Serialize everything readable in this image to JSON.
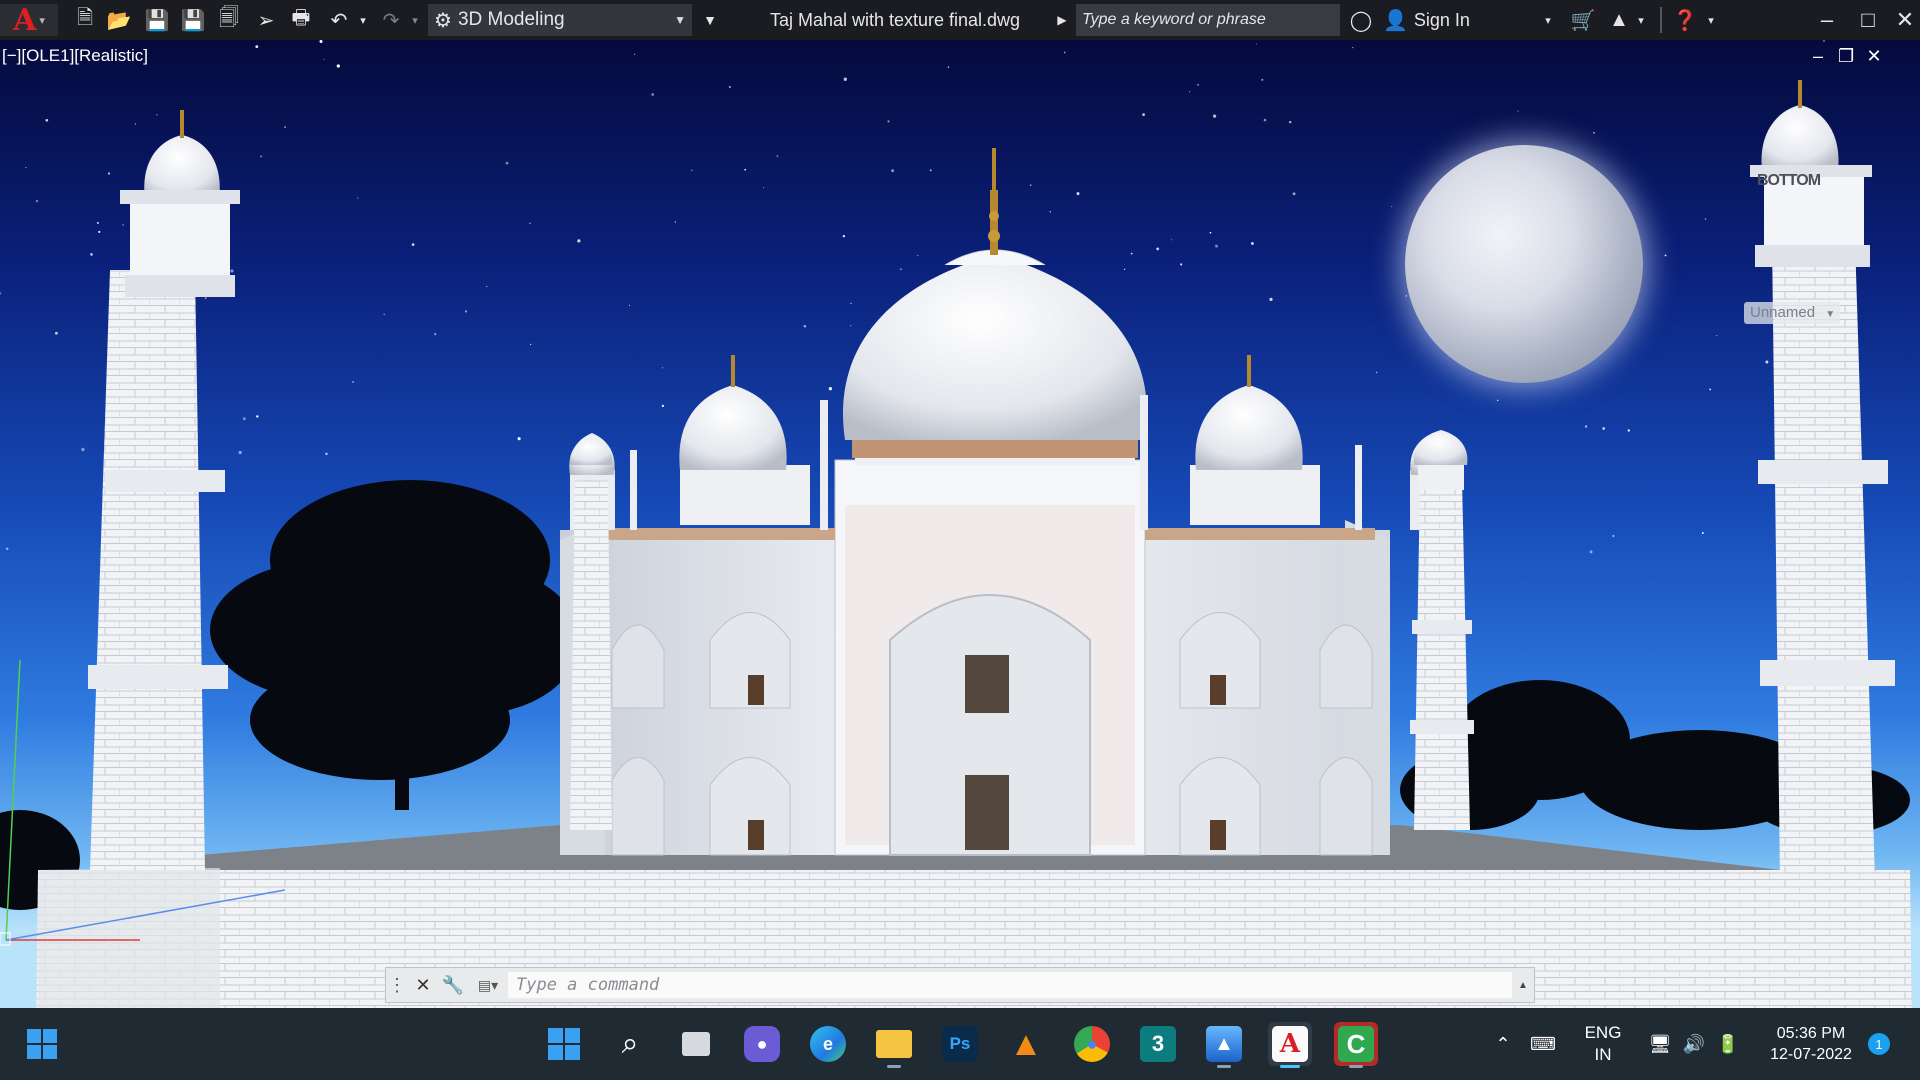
{
  "app": {
    "logo": "A",
    "workspace": "3D Modeling",
    "document_title": "Taj Mahal with texture final.dwg",
    "search_placeholder": "Type a keyword or phrase",
    "sign_in": "Sign In",
    "quick_access_icons": [
      "new-icon",
      "open-icon",
      "save-icon",
      "save-as-icon",
      "open-from-web-icon",
      "plot-export-icon",
      "plot-icon",
      "undo-icon",
      "redo-icon"
    ],
    "window_controls": [
      "minimize-icon",
      "maximize-icon",
      "close-icon"
    ]
  },
  "viewport": {
    "label": "[−][OLE1][Realistic]",
    "viewcube_face": "BOTTOM",
    "ucs_name": "Unnamed",
    "sky_top": "#050a3c",
    "sky_bottom": "#b9e2fb"
  },
  "command_line": {
    "placeholder": "Type a command"
  },
  "taskbar": {
    "pinned": [
      {
        "name": "search-icon",
        "label": "⌕"
      },
      {
        "name": "task-view-icon",
        "label": "▢"
      },
      {
        "name": "teams-chat-icon",
        "label": "■"
      },
      {
        "name": "edge-icon",
        "label": "e"
      },
      {
        "name": "file-explorer-icon",
        "label": "▬"
      },
      {
        "name": "photoshop-icon",
        "label": "Ps"
      },
      {
        "name": "vlc-icon",
        "label": "▲"
      },
      {
        "name": "chrome-icon",
        "label": "●"
      },
      {
        "name": "3dsmax-icon",
        "label": "3"
      },
      {
        "name": "photos-icon",
        "label": "▲"
      },
      {
        "name": "autocad-icon",
        "label": "A"
      },
      {
        "name": "camtasia-icon",
        "label": "C"
      }
    ],
    "language_line1": "ENG",
    "language_line2": "IN",
    "time": "05:36 PM",
    "date": "12-07-2022",
    "notification_count": "1"
  }
}
